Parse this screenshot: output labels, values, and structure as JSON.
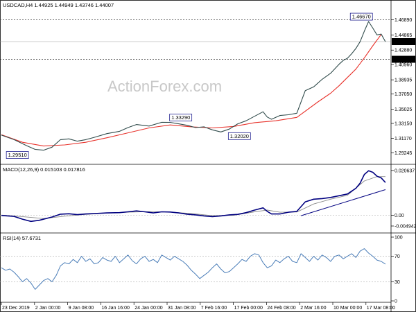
{
  "chart_data": [
    {
      "type": "line",
      "panel": "price",
      "title": "USDCAD,H4  1.44925 1.44949 1.43746 1.44007",
      "ylim": [
        1.28,
        1.4925
      ],
      "y_ticks": [
        "1.46890",
        "1.44865",
        "1.42880",
        "1.40960",
        "1.38935",
        "1.37050",
        "1.35025",
        "1.33150",
        "1.31170",
        "1.29245"
      ],
      "current_price_label": "1.44007",
      "current_price": 1.44007,
      "level_label": "1.41660",
      "level": 1.4166,
      "top_level": 1.4689,
      "annotations": [
        {
          "text": "1.46670",
          "x": 85.3,
          "y": 1.4667
        },
        {
          "text": "1.33290",
          "x": 42.5,
          "y": 1.3329
        },
        {
          "text": "1.32020",
          "x": 56.4,
          "y": 1.3202
        },
        {
          "text": "1.29510",
          "x": 3.8,
          "y": 1.2951
        }
      ],
      "watermark": "ActionForex.com",
      "series": [
        {
          "color": "#2f4a4a",
          "x": [
            0,
            3,
            6,
            8,
            10,
            12,
            14,
            16,
            18,
            20,
            22,
            25,
            28,
            30,
            32,
            35,
            38,
            40,
            42,
            44,
            46,
            48,
            50,
            52,
            54,
            56,
            58,
            60,
            62,
            63,
            64,
            66,
            68,
            70,
            72,
            74,
            76,
            77,
            78,
            79,
            80,
            81,
            82,
            83,
            84,
            85,
            86,
            87,
            88,
            89,
            90,
            91
          ],
          "y": [
            1.316,
            1.31,
            1.302,
            1.297,
            1.296,
            1.3,
            1.31,
            1.311,
            1.308,
            1.31,
            1.313,
            1.318,
            1.321,
            1.326,
            1.33,
            1.328,
            1.333,
            1.3329,
            1.331,
            1.329,
            1.326,
            1.327,
            1.323,
            1.3202,
            1.324,
            1.331,
            1.335,
            1.341,
            1.347,
            1.34,
            1.337,
            1.342,
            1.343,
            1.345,
            1.375,
            1.38,
            1.39,
            1.394,
            1.398,
            1.404,
            1.41,
            1.415,
            1.418,
            1.424,
            1.431,
            1.44,
            1.454,
            1.4667,
            1.458,
            1.449,
            1.45,
            1.44
          ]
        },
        {
          "color": "#e8322b",
          "x": [
            0,
            5,
            10,
            15,
            20,
            25,
            30,
            35,
            40,
            45,
            50,
            55,
            60,
            65,
            70,
            75,
            78,
            80,
            82,
            84,
            86,
            88,
            90
          ],
          "y": [
            1.3165,
            1.3065,
            1.3015,
            1.303,
            1.3065,
            1.3125,
            1.319,
            1.3255,
            1.3295,
            1.327,
            1.3255,
            1.3275,
            1.3325,
            1.335,
            1.3395,
            1.36,
            1.3715,
            1.3815,
            1.3925,
            1.4035,
            1.4185,
            1.4345,
            1.4495
          ]
        }
      ]
    },
    {
      "type": "line",
      "panel": "macd",
      "title": "MACD(12,26,9) 0.015103 0.017816",
      "ylim": [
        -0.0075,
        0.0225
      ],
      "y_ticks": [
        "0.020637",
        "0.00",
        "-0.004942"
      ],
      "series": [
        {
          "color": "#000080",
          "x": [
            0,
            3,
            5,
            7,
            9,
            12,
            14,
            16,
            18,
            20,
            22,
            25,
            28,
            30,
            32,
            34,
            36,
            38,
            40,
            42,
            44,
            46,
            48,
            50,
            52,
            54,
            56,
            58,
            60,
            62,
            63,
            64,
            66,
            68,
            70,
            72,
            74,
            76,
            78,
            80,
            82,
            84,
            85,
            86,
            87,
            88,
            89,
            90,
            91
          ],
          "y": [
            -0.0001,
            -0.0005,
            -0.0018,
            -0.0028,
            -0.0023,
            -0.0008,
            0.0005,
            0.0007,
            0.0003,
            0.0006,
            0.0008,
            0.0011,
            0.0012,
            0.0016,
            0.002,
            0.0016,
            0.0011,
            0.0016,
            0.0015,
            0.0011,
            0.0005,
            0.0002,
            -0.0003,
            -0.0006,
            -0.0003,
            0.0002,
            0.0004,
            0.0012,
            0.0024,
            0.0034,
            0.0018,
            0.0006,
            0.0006,
            0.0014,
            0.0018,
            0.0062,
            0.0074,
            0.0077,
            0.0082,
            0.009,
            0.0098,
            0.0124,
            0.0148,
            0.0188,
            0.0205,
            0.0198,
            0.018,
            0.0172,
            0.0151
          ]
        },
        {
          "color": "#8a8a8a",
          "x": [
            0,
            5,
            10,
            15,
            20,
            25,
            30,
            35,
            40,
            45,
            50,
            55,
            60,
            63,
            66,
            70,
            74,
            78,
            82,
            86,
            89,
            91
          ],
          "y": [
            0.0001,
            -0.0006,
            -0.0015,
            -0.0004,
            0.0004,
            0.001,
            0.0014,
            0.0017,
            0.0015,
            0.0008,
            -0.0002,
            0,
            0.0016,
            0.0024,
            0.0014,
            0.0015,
            0.0052,
            0.0074,
            0.0092,
            0.0158,
            0.0178,
            0.0178
          ]
        }
      ],
      "trendline": {
        "x": [
          71,
          91
        ],
        "y": [
          -0.0002,
          0.0118
        ]
      }
    },
    {
      "type": "line",
      "panel": "rsi",
      "title": "RSI(14) 57.6731",
      "ylim": [
        0,
        100
      ],
      "y_ticks": [
        "100",
        "70",
        "30",
        "0"
      ],
      "x_ticks": [
        "23 Dec 2019",
        "2 Jan 00:00",
        "9 Jan 08:00",
        "16 Jan 16:00",
        "24 Jan 00:00",
        "31 Jan 08:00",
        "7 Feb 16:00",
        "17 Feb 00:00",
        "24 Feb 08:00",
        "2 Mar 16:00",
        "10 Mar 00:00",
        "17 Mar 08:00"
      ],
      "series": [
        {
          "color": "#4a7db8",
          "x": [
            0,
            1,
            2,
            3,
            4,
            5,
            6,
            7,
            8,
            9,
            10,
            11,
            12,
            13,
            14,
            15,
            16,
            17,
            18,
            19,
            20,
            21,
            22,
            23,
            24,
            25,
            26,
            27,
            28,
            29,
            30,
            31,
            32,
            33,
            34,
            35,
            36,
            37,
            38,
            39,
            40,
            41,
            42,
            43,
            44,
            45,
            46,
            47,
            48,
            49,
            50,
            51,
            52,
            53,
            54,
            55,
            56,
            57,
            58,
            59,
            60,
            61,
            62,
            63,
            64,
            65,
            66,
            67,
            68,
            69,
            70,
            71,
            72,
            73,
            74,
            75,
            76,
            77,
            78,
            79,
            80,
            81,
            82,
            83,
            84,
            85,
            86,
            87,
            88,
            89,
            90,
            91
          ],
          "y": [
            52,
            48,
            50,
            45,
            38,
            30,
            35,
            28,
            18,
            25,
            32,
            35,
            30,
            40,
            55,
            60,
            58,
            65,
            60,
            70,
            62,
            66,
            58,
            60,
            68,
            64,
            62,
            70,
            60,
            66,
            72,
            63,
            58,
            66,
            70,
            62,
            65,
            60,
            72,
            68,
            64,
            70,
            66,
            62,
            56,
            48,
            42,
            35,
            40,
            45,
            52,
            58,
            50,
            44,
            46,
            52,
            58,
            65,
            62,
            70,
            74,
            72,
            60,
            52,
            55,
            64,
            60,
            66,
            70,
            62,
            60,
            74,
            68,
            62,
            70,
            64,
            72,
            68,
            62,
            70,
            72,
            66,
            70,
            74,
            68,
            78,
            82,
            75,
            70,
            64,
            62,
            57.67
          ]
        }
      ]
    }
  ]
}
